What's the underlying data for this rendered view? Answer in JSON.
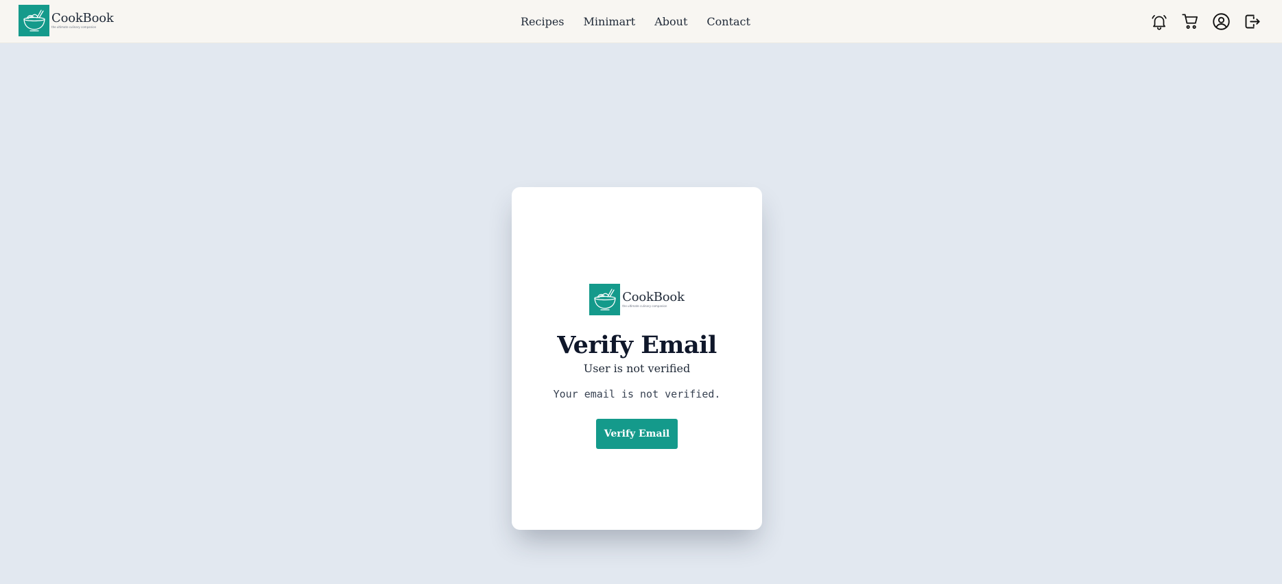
{
  "header": {
    "brand": {
      "name": "CookBook",
      "tagline": "the ultimate culinary companion"
    },
    "nav": [
      {
        "label": "Recipes"
      },
      {
        "label": "Minimart"
      },
      {
        "label": "About"
      },
      {
        "label": "Contact"
      }
    ],
    "icons": [
      "bell-icon",
      "cart-icon",
      "user-circle-icon",
      "logout-icon"
    ]
  },
  "card": {
    "brand": {
      "name": "CookBook",
      "tagline": "the ultimate culinary companion"
    },
    "title": "Verify Email",
    "subtitle": "User is not verified",
    "message": "Your email is not verified.",
    "button_label": "Verify Email"
  },
  "colors": {
    "accent": "#149a8b",
    "page_background": "#e2e8f0",
    "header_background": "#f8f6f2"
  }
}
